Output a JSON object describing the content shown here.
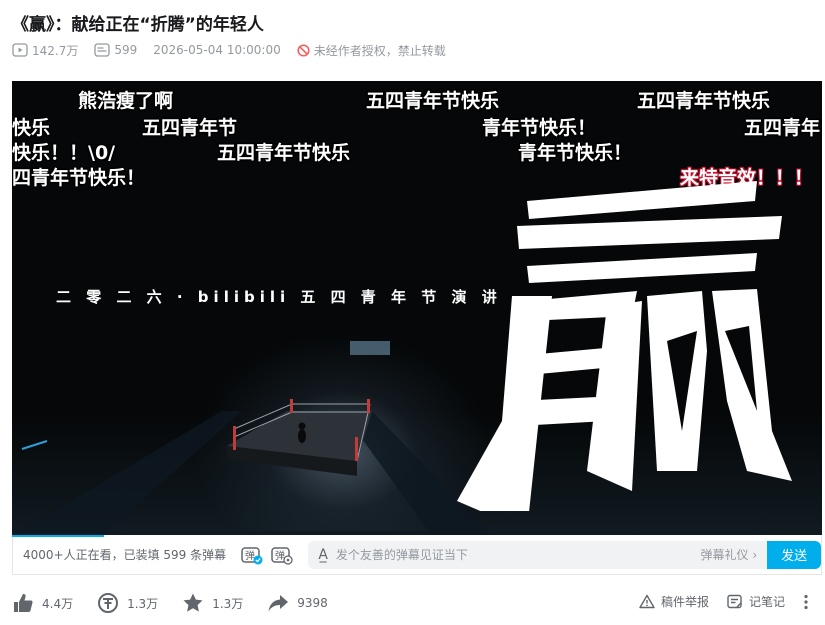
{
  "video": {
    "title": "《赢》：献给正在“折腾”的年轻人",
    "views": "142.7万",
    "danmaku_count": "599",
    "datetime": "2026-05-04 10:00:00",
    "copyright": "未经作者授权，禁止转载"
  },
  "player": {
    "slogan": "二 零 二 六 · bilibili 五 四 青 年 节 演 讲",
    "danmaku": [
      {
        "text": "熊浩瘦了啊"
      },
      {
        "text": "五四青年节快乐"
      },
      {
        "text": "五四青年节快乐"
      },
      {
        "text": "快乐"
      },
      {
        "text": "五四青年节"
      },
      {
        "text": "青年节快乐！"
      },
      {
        "text": "五四青年"
      },
      {
        "text": "快乐！！\\0/"
      },
      {
        "text": "五四青年节快乐"
      },
      {
        "text": "青年节快乐！"
      },
      {
        "text": "四青年节快乐！"
      },
      {
        "text": "来特音效！！！"
      }
    ]
  },
  "danmaku_bar": {
    "viewers": "4000+人正在看，已装填 599 条弹幕",
    "placeholder": "发个友善的弹幕见证当下",
    "etiquette": "弹幕礼仪 ›",
    "send": "发送"
  },
  "actions": {
    "like": "4.4万",
    "coin": "1.3万",
    "favorite": "1.3万",
    "share": "9398",
    "report": "稿件举报",
    "notes": "记笔记"
  },
  "icons": {
    "play_count": "play-icon",
    "danmaku": "danmaku-icon",
    "forbid": "forbid-icon"
  },
  "colors": {
    "accent": "#00aeec",
    "forbid": "#f85a54"
  }
}
